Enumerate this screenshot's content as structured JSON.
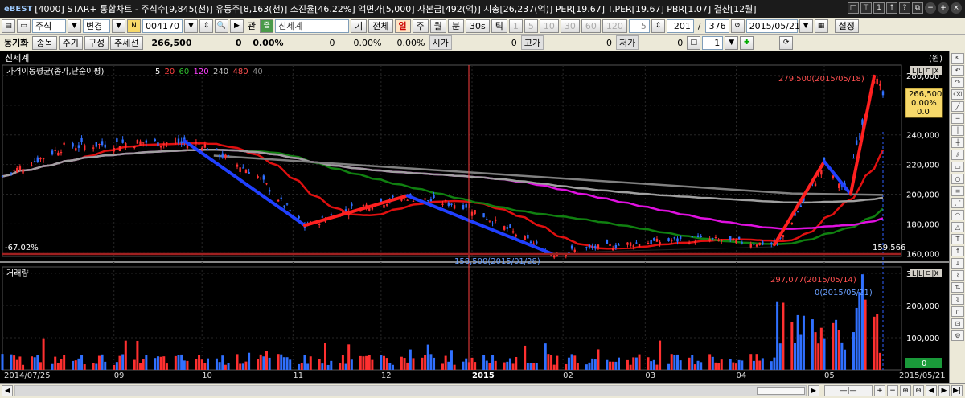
{
  "titlebar": {
    "logo": "eBEST",
    "text": "[4000] STAR+ 통합차트 - 주식수[9,845(천)] 유동주[8,163(천)] 소진율[46.22%] 액면가[5,000] 자본금[492(억)] 시총[26,237(억)] PER[19.67] T.PER[19.67] PBR[1.07] 결산[12월]"
  },
  "toolbar1": {
    "market": "주식",
    "change_btn": "변경",
    "code": "004170",
    "tag": "관",
    "name": "신세계",
    "btn_gi": "기",
    "btn_all": "전체",
    "period_tabs": [
      "일",
      "주",
      "월",
      "분",
      "30s",
      "틱"
    ],
    "active_tab": "일",
    "minute_opts": [
      "1",
      "5",
      "10",
      "30",
      "60",
      "120"
    ],
    "interval": "5",
    "count": "201",
    "total": "376",
    "date": "2015/05/21",
    "settings": "설정"
  },
  "toolbar2": {
    "label": "동기화",
    "btn_item": "종목",
    "btn_cycle": "주기",
    "btn_comp": "구성",
    "btn_trend": "추세선",
    "price": "266,500",
    "change": "0",
    "pct": "0.00%",
    "f1": "0",
    "f2": "0.00%",
    "f3": "0.00%",
    "open_lab": "시가",
    "open_val": "0",
    "high_lab": "고가",
    "high_val": "0",
    "low_lab": "저가",
    "low_val": "0",
    "num": "1"
  },
  "chart": {
    "stock_name": "신세계",
    "unit": "(원)",
    "price_panel_label": "가격이동평균(종가,단순이평)",
    "ma_periods": [
      "5",
      "20",
      "60",
      "120",
      "240",
      "480",
      "40"
    ],
    "volume_panel_label": "거래량",
    "pct_label": "-67.02%",
    "min_price_label": "159,566",
    "hi_annot": "279,500(2015/05/18)",
    "lo_annot": "158,500(2015/01/28)",
    "vol_hi_annot": "297,077(2015/05/14)",
    "vol_last_annot": "0(2015/05/21)",
    "cur_box": [
      "266,500",
      "0.00%",
      "0.0"
    ],
    "vol_badge": "0",
    "panel_btns": "L|L|ㅁ|X"
  },
  "colors": {
    "up": "#ff3030",
    "down": "#3070ff",
    "ma5": "#000000",
    "ma20": "#e01010",
    "ma60": "#108010",
    "ma120": "#e010e0",
    "ma240": "#a0a0a0",
    "ma480": "#808080",
    "background": "#000000"
  },
  "chart_data": {
    "type": "candlestick",
    "x_range": [
      "2014/07/25",
      "2015/05/21"
    ],
    "x_ticks": [
      "2014/07/25",
      "09",
      "10",
      "11",
      "12",
      "2015",
      "02",
      "03",
      "04",
      "05",
      "2015/05/21"
    ],
    "price_axis_ticks": [
      160000,
      180000,
      200000,
      220000,
      240000,
      260000,
      280000
    ],
    "price_ylim": [
      158000,
      287000
    ],
    "volume_axis_ticks": [
      100000,
      200000,
      300000
    ],
    "volume_ylim": [
      0,
      320000
    ],
    "approx_close_path": [
      {
        "date": "2014/07/25",
        "close": 212000
      },
      {
        "date": "2014/08/15",
        "close": 232000
      },
      {
        "date": "2014/09/10",
        "close": 235000
      },
      {
        "date": "2014/10/01",
        "close": 234000
      },
      {
        "date": "2014/10/20",
        "close": 212000
      },
      {
        "date": "2014/11/05",
        "close": 178000
      },
      {
        "date": "2014/11/20",
        "close": 190000
      },
      {
        "date": "2014/12/10",
        "close": 198000
      },
      {
        "date": "2014/12/30",
        "close": 192000
      },
      {
        "date": "2015/01/28",
        "close": 160000
      },
      {
        "date": "2015/02/25",
        "close": 167000
      },
      {
        "date": "2015/03/20",
        "close": 170000
      },
      {
        "date": "2015/04/15",
        "close": 166000
      },
      {
        "date": "2015/04/25",
        "close": 198000
      },
      {
        "date": "2015/05/01",
        "close": 220000
      },
      {
        "date": "2015/05/08",
        "close": 203000
      },
      {
        "date": "2015/05/18",
        "close": 279500
      },
      {
        "date": "2015/05/21",
        "close": 266500
      }
    ],
    "annotations": [
      {
        "label": "279,500(2015/05/18)",
        "price": 279500,
        "date": "2015/05/18"
      },
      {
        "label": "158,500(2015/01/28)",
        "price": 158500,
        "date": "2015/01/28"
      },
      {
        "label": "297,077(2015/05/14)",
        "volume": 297077,
        "date": "2015/05/14"
      },
      {
        "label": "0(2015/05/21)",
        "volume": 0,
        "date": "2015/05/21"
      }
    ],
    "moving_averages": [
      "5",
      "20",
      "60",
      "120",
      "240",
      "480"
    ],
    "trendlines": [
      {
        "color": "blue",
        "from": {
          "date": "2014/09/25",
          "price": 236000
        },
        "to": {
          "date": "2014/11/05",
          "price": 179000
        }
      },
      {
        "color": "red",
        "from": {
          "date": "2014/11/05",
          "price": 179000
        },
        "to": {
          "date": "2014/12/10",
          "price": 199000
        }
      },
      {
        "color": "blue",
        "from": {
          "date": "2014/12/10",
          "price": 199000
        },
        "to": {
          "date": "2015/01/28",
          "price": 160000
        }
      },
      {
        "color": "red",
        "from": {
          "date": "2015/04/14",
          "price": 166000
        },
        "to": {
          "date": "2015/05/01",
          "price": 222000
        }
      },
      {
        "color": "blue",
        "from": {
          "date": "2015/05/01",
          "price": 222000
        },
        "to": {
          "date": "2015/05/10",
          "price": 200000
        }
      },
      {
        "color": "red",
        "from": {
          "date": "2015/05/10",
          "price": 200000
        },
        "to": {
          "date": "2015/05/18",
          "price": 279500
        }
      }
    ],
    "grid": true,
    "legend_position": "top-left"
  }
}
